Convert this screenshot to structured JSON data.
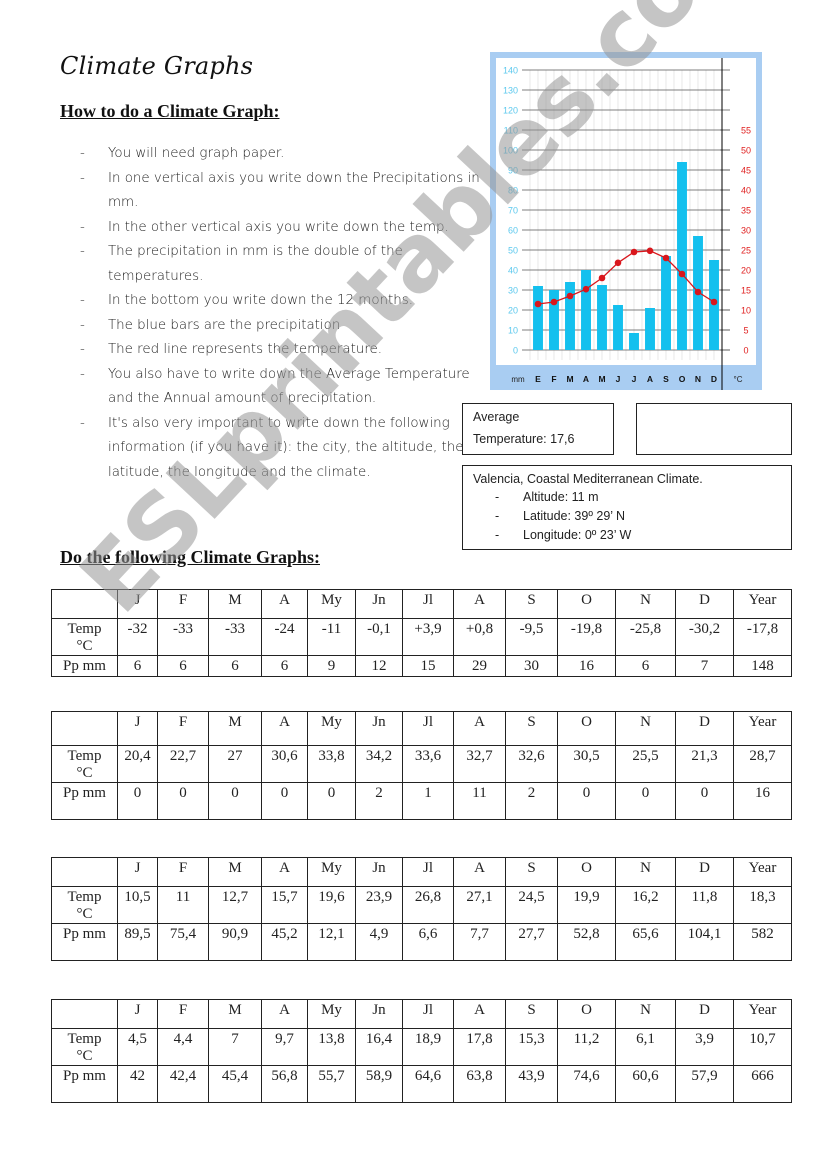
{
  "page": {
    "title": "Climate Graphs",
    "section_how": "How to do a Climate Graph:",
    "section_do": "Do the following Climate Graphs:",
    "watermark": "ESLprintables.com"
  },
  "instructions": [
    {
      "dash": "-",
      "text": "You will need graph paper."
    },
    {
      "dash": "-",
      "text": "In one vertical axis you write down the Precipitations in mm."
    },
    {
      "dash": "-",
      "text": "In the other vertical axis you write down the temp."
    },
    {
      "dash": "-",
      "text": "The precipitation in mm is the double of the temperatures."
    },
    {
      "dash": "-",
      "text": "In the bottom you write down the 12 months."
    },
    {
      "dash": "-",
      "text": "The blue bars are the precipitation"
    },
    {
      "dash": "-",
      "text": "The red line represents the temperature."
    },
    {
      "dash": "-",
      "text": "You also have to write down the Average Temperature and the Annual amount of precipitation."
    },
    {
      "dash": "-",
      "text": "It's also very important to write down the following information (if you have it): the city, the altitude, the latitude, the longitude and the climate."
    }
  ],
  "info": {
    "avg_label": "Average",
    "avg_value": "Temperature: 17,6",
    "annual_box": "",
    "city": "Valencia, Coastal Mediterranean Climate.",
    "items": [
      {
        "dash": "-",
        "text": "Altitude: 11 m"
      },
      {
        "dash": "-",
        "text": "Latitude: 39º  29’ N"
      },
      {
        "dash": "-",
        "text": "Longitude: 0º 23’ W"
      }
    ]
  },
  "chart_data": {
    "type": "bar",
    "title": "",
    "categories": [
      "E",
      "F",
      "M",
      "A",
      "M",
      "J",
      "J",
      "A",
      "S",
      "O",
      "N",
      "D"
    ],
    "xlabel_left": "mm",
    "xlabel_right": "°C",
    "series": [
      {
        "name": "Precipitation (mm)",
        "type": "bar",
        "axis": "left",
        "color": "#14c0ee",
        "values": [
          32,
          30,
          34,
          40,
          32.5,
          22.5,
          8.5,
          21,
          47,
          94,
          57,
          45
        ]
      },
      {
        "name": "Temperature (°C)",
        "type": "line",
        "axis": "right",
        "color": "#d9161c",
        "values": [
          11.5,
          12,
          13.5,
          15.2,
          18,
          21.8,
          24.5,
          24.8,
          23,
          19,
          14.5,
          12
        ]
      }
    ],
    "y_left": {
      "label": "mm",
      "ylim": [
        0,
        140
      ],
      "ticks": [
        0,
        10,
        20,
        30,
        40,
        50,
        60,
        70,
        80,
        90,
        100,
        110,
        120,
        130,
        140
      ],
      "color": "#5bc8ee"
    },
    "y_right": {
      "label": "°C",
      "ylim": [
        0,
        70
      ],
      "ticks": [
        0,
        5,
        10,
        15,
        20,
        25,
        30,
        35,
        40,
        45,
        50,
        55
      ],
      "color": "#e02020"
    },
    "grid": true,
    "legend": "none"
  },
  "tables": [
    {
      "header": [
        "",
        "J",
        "F",
        "M",
        "A",
        "My",
        "Jn",
        "Jl",
        "A",
        "S",
        "O",
        "N",
        "D",
        "Year"
      ],
      "rows": [
        [
          "Temp °C",
          "-32",
          "-33",
          "-33",
          "-24",
          "-11",
          "-0,1",
          "+3,9",
          "+0,8",
          "-9,5",
          "-19,8",
          "-25,8",
          "-30,2",
          "-17,8"
        ],
        [
          "Pp mm",
          "6",
          "6",
          "6",
          "6",
          "9",
          "12",
          "15",
          "29",
          "30",
          "16",
          "6",
          "7",
          "148"
        ]
      ]
    },
    {
      "header": [
        "",
        "J",
        "F",
        "M",
        "A",
        "My",
        "Jn",
        "Jl",
        "A",
        "S",
        "O",
        "N",
        "D",
        "Year"
      ],
      "rows": [
        [
          "Temp °C",
          "20,4",
          "22,7",
          "27",
          "30,6",
          "33,8",
          "34,2",
          "33,6",
          "32,7",
          "32,6",
          "30,5",
          "25,5",
          "21,3",
          "28,7"
        ],
        [
          "Pp mm",
          "0",
          "0",
          "0",
          "0",
          "0",
          "2",
          "1",
          "11",
          "2",
          "0",
          "0",
          "0",
          "16"
        ]
      ]
    },
    {
      "header": [
        "",
        "J",
        "F",
        "M",
        "A",
        "My",
        "Jn",
        "Jl",
        "A",
        "S",
        "O",
        "N",
        "D",
        "Year"
      ],
      "rows": [
        [
          "Temp °C",
          "10,5",
          "11",
          "12,7",
          "15,7",
          "19,6",
          "23,9",
          "26,8",
          "27,1",
          "24,5",
          "19,9",
          "16,2",
          "11,8",
          "18,3"
        ],
        [
          "Pp mm",
          "89,5",
          "75,4",
          "90,9",
          "45,2",
          "12,1",
          "4,9",
          "6,6",
          "7,7",
          "27,7",
          "52,8",
          "65,6",
          "104,1",
          "582"
        ]
      ]
    },
    {
      "header": [
        "",
        "J",
        "F",
        "M",
        "A",
        "My",
        "Jn",
        "Jl",
        "A",
        "S",
        "O",
        "N",
        "D",
        "Year"
      ],
      "rows": [
        [
          "Temp °C",
          "4,5",
          "4,4",
          "7",
          "9,7",
          "13,8",
          "16,4",
          "18,9",
          "17,8",
          "15,3",
          "11,2",
          "6,1",
          "3,9",
          "10,7"
        ],
        [
          "Pp mm",
          "42",
          "42,4",
          "45,4",
          "56,8",
          "55,7",
          "58,9",
          "64,6",
          "63,8",
          "43,9",
          "74,6",
          "60,6",
          "57,9",
          "666"
        ]
      ]
    }
  ]
}
